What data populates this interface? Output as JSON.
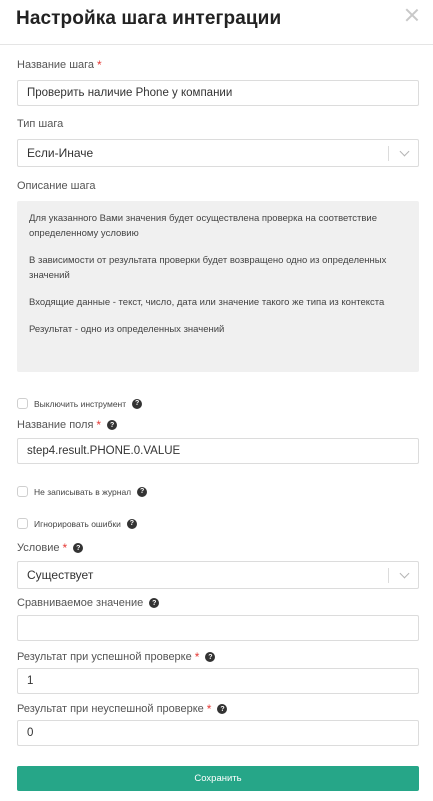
{
  "header": {
    "title": "Настройка шага интеграции"
  },
  "form": {
    "step_name": {
      "label": "Название шага",
      "required": "*",
      "value": "Проверить наличие Phone у компании"
    },
    "step_type": {
      "label": "Тип шага",
      "value": "Если-Иначе"
    },
    "description": {
      "label": "Описание шага",
      "paragraphs": [
        "Для указанного Вами значения будет осуществлена проверка на соответствие определенному условию",
        "В зависимости от результата проверки будет возвращено одно из определенных значений",
        "Входящие данные - текст, число, дата или значение такого же типа из контекста",
        "Результат - одно из определенных значений"
      ]
    },
    "disable_tool": {
      "label": "Выключить инструмент",
      "checked": false
    },
    "field_name": {
      "label": "Название поля",
      "required": "*",
      "value": "step4.result.PHONE.0.VALUE"
    },
    "no_journal": {
      "label": "Не записывать в журнал",
      "checked": false
    },
    "ignore_errors": {
      "label": "Игнорировать ошибки",
      "checked": false
    },
    "condition": {
      "label": "Условие",
      "required": "*",
      "value": "Существует"
    },
    "compare_value": {
      "label": "Сравниваемое значение",
      "value": ""
    },
    "success_result": {
      "label": "Результат при успешной проверке",
      "required": "*",
      "value": "1"
    },
    "fail_result": {
      "label": "Результат при неуспешной проверке",
      "required": "*",
      "value": "0"
    },
    "help_icon": "?",
    "save_label": "Сохранить"
  },
  "colors": {
    "accent": "#26a688",
    "required": "#e53935",
    "description_bg": "#f0f0f0"
  }
}
